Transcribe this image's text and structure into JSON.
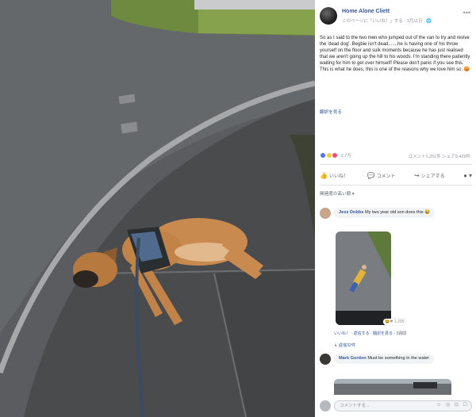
{
  "post": {
    "author": "Home Alone Cliett",
    "meta": "このページに「いいね！」する · 3月11日 · 🌐",
    "more_icon": "more-dots-icon",
    "body": "So as I said to the two men who jumped out of the van to try and revive the 'dead dog'. Begbie isn't dead.......he is having one of his throw yourself on the floor and sulk moments because he has just realised that we aren't going up the hill to his woods. I'm standing there patiently waiting for him to get over himself! Please don't panic if you see this. This is what he does, this is one of the reasons why we love him so. 😡",
    "see_translation": "翻訳を見る"
  },
  "reactions": {
    "count": "2.7万",
    "stats": "コメント1,251件  シェア9,429件",
    "icons": [
      "like-icon",
      "haha-icon",
      "love-icon"
    ]
  },
  "actions": {
    "like": "いいね！",
    "comment": "コメント",
    "share": "シェアする"
  },
  "sort_label": "関連度の高い順 ▾",
  "comments": [
    {
      "name": "Jess Dobbs",
      "text": "My two year old son does this 😂",
      "links": [
        "いいね！",
        "返信する",
        "翻訳を見る",
        "3週間"
      ],
      "reaction_count": "1,205",
      "replies": "返信32件"
    },
    {
      "name": "Mark Gordon",
      "text": "Must be something in the water"
    }
  ],
  "write_comment": {
    "placeholder": "コメントする...",
    "icons": "☺ ◎ ⊡ ☐"
  },
  "colors": {
    "facebook_link": "#385898",
    "bubble_bg": "#f2f3f5"
  }
}
